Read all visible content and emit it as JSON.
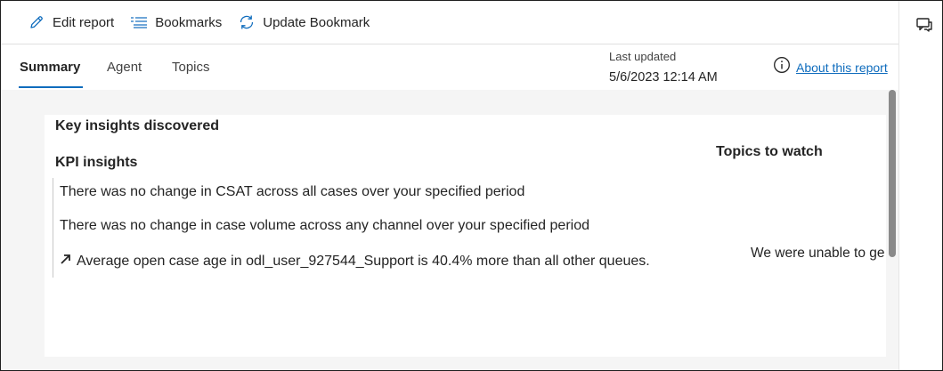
{
  "toolbar": {
    "edit_report": "Edit report",
    "bookmarks": "Bookmarks",
    "update_bookmark": "Update Bookmark"
  },
  "tabs": [
    {
      "label": "Summary",
      "active": true
    },
    {
      "label": "Agent",
      "active": false
    },
    {
      "label": "Topics",
      "active": false
    }
  ],
  "last_updated": {
    "label": "Last updated",
    "value": "5/6/2023 12:14 AM"
  },
  "about": {
    "link": "About this report"
  },
  "card": {
    "title": "Key insights discovered",
    "kpi_title": "KPI insights",
    "insights": [
      "There was no change in CSAT across all cases over your specified period",
      "There was no change in case volume across any channel over your specified period",
      "Average open case age in odl_user_927544_Support is 40.4% more than all other queues."
    ],
    "topics_title": "Topics to watch",
    "topics_message": "We were unable to ge"
  },
  "colors": {
    "accent": "#0f6cbd",
    "content_bg": "#f5f5f5",
    "scroll_thumb": "#8a8a8a"
  },
  "icons": {
    "edit": "pencil-icon",
    "bookmarks": "list-icon",
    "update": "refresh-icon",
    "rail": "comment-icon",
    "info": "info-icon",
    "trend": "arrow-up-right-icon"
  }
}
